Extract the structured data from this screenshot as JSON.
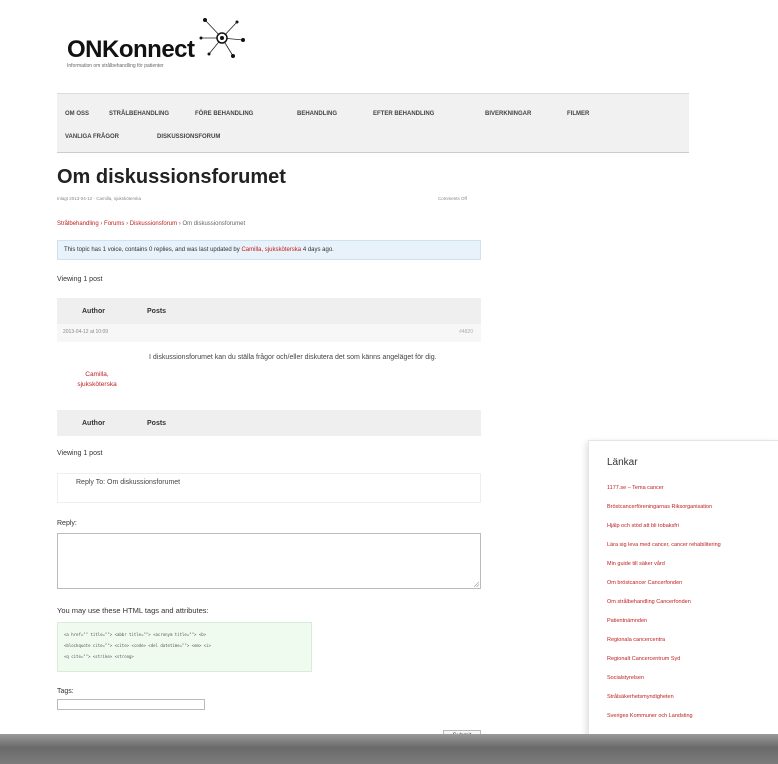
{
  "site": {
    "title": "ONKonnect",
    "tagline": "Information om strålbehandling för patienter"
  },
  "nav": {
    "items": [
      "OM OSS",
      "STRÅLBEHANDLING",
      "FÖRE BEHANDLING",
      "BEHANDLING",
      "EFTER BEHANDLING",
      "BIVERKNINGAR",
      "FILMER",
      "VANLIGA FRÅGOR",
      "DISKUSSIONSFORUM"
    ]
  },
  "post": {
    "title": "Om diskussionsforumet",
    "meta": "Inlagt 2013-04-12 - Camilla, sjuksköterska",
    "comments": "Comments Off",
    "breadcrumb": [
      "Strålbehandling",
      "Forums",
      "Diskussionsforum",
      "Om diskussionsforumet"
    ],
    "notice": {
      "prefix": "This topic has 1 voice, contains 0 replies, and was last updated by",
      "author": "Camilla, sjuksköterska",
      "suffix": "4 days ago."
    },
    "viewing": "Viewing 1 post",
    "col_author": "Author",
    "col_posts": "Posts",
    "date": "2013-04-12 at 10:09",
    "permalink": "#4820",
    "author_name": "Camilla, sjuksköterska",
    "body": "I diskussionsforumet kan du ställa frågor och/eller diskutera det som känns angeläget för dig."
  },
  "reply": {
    "heading": "Reply To: Om diskussionsforumet",
    "label": "Reply:",
    "tags_heading": "You may use these HTML tags and attributes:",
    "code": [
      "<a href=\"\" title=\"\"> <abbr title=\"\"> <acronym title=\"\"> <b>",
      "<blockquote cite=\"\"> <cite> <code> <del datetime=\"\"> <em> <i>",
      "<q cite=\"\"> <strike> <strong>"
    ],
    "tags_label": "Tags:",
    "submit": "Submit"
  },
  "sidebar": {
    "title": "Länkar",
    "links": [
      "1177.se – Tema cancer",
      "Bröstcancerföreningarnas Riksorganisation",
      "Hjälp och stöd att bli tobaksfri",
      "Lära sig leva med cancer, cancer rehabilitering",
      "Min guide till säker vård",
      "Om bröstcancer Cancerfonden",
      "Om strålbehandling Cancerfonden",
      "Patientnämnden",
      "Regionala cancercentra",
      "Regionalt Cancercentrum Syd",
      "Socialstyrelsen",
      "Strålsäkerhetsmyndigheten",
      "Sveriges Kommuner och Landsting"
    ]
  }
}
